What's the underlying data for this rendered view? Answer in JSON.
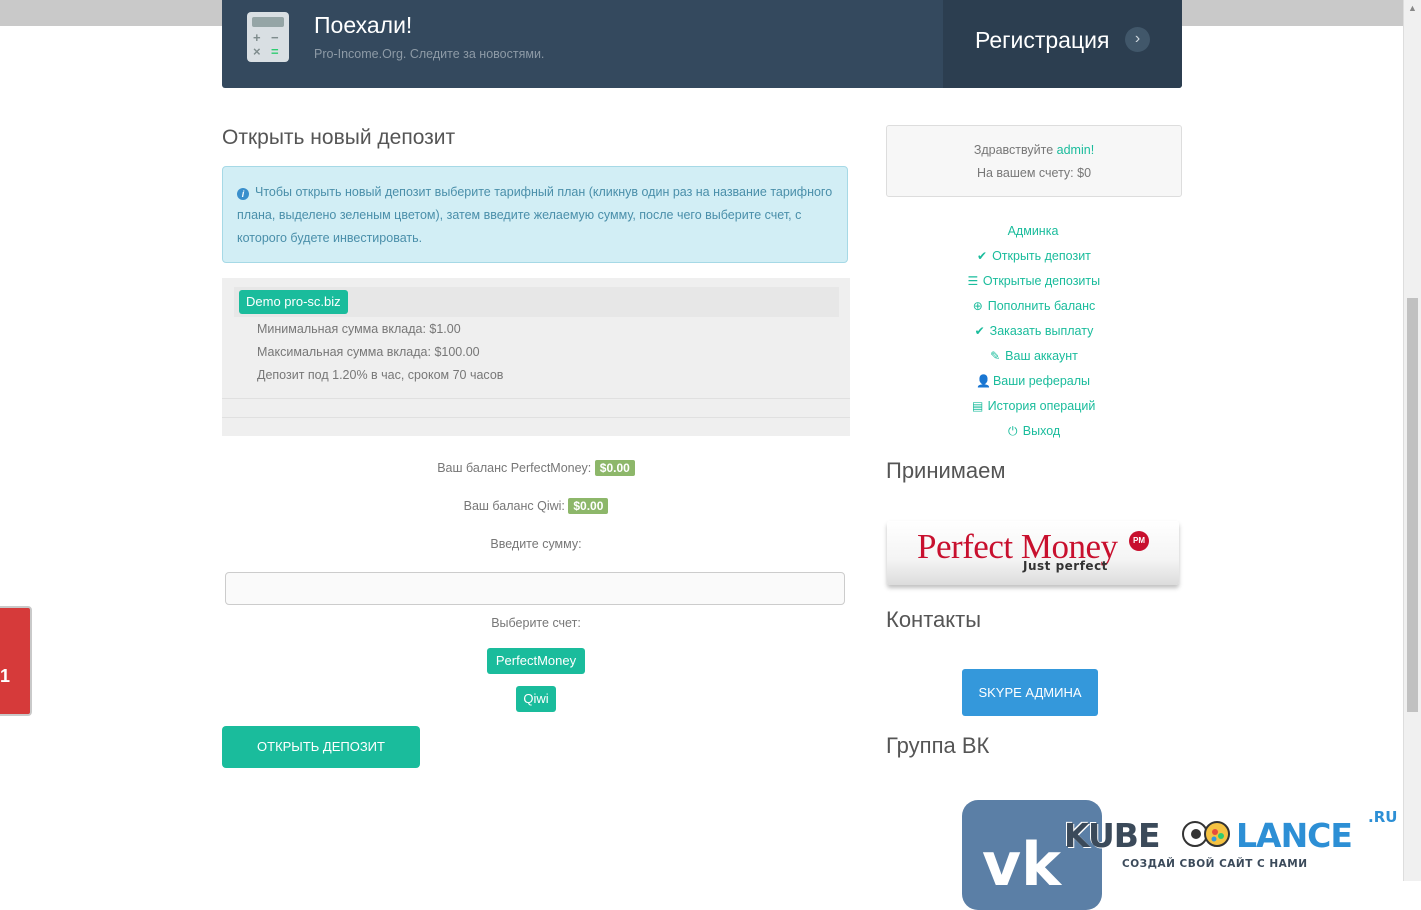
{
  "header": {
    "title": "Поехали!",
    "subtitle": "Pro-Income.Org. Следите за новостями.",
    "register_label": "Регистрация",
    "register_arrow": "›"
  },
  "main": {
    "title": "Открыть новый депозит",
    "info_text": "Чтобы открыть новый депозит выберите тарифный план (кликнув один раз на название тарифного плана, выделено зеленым цветом), затем введите желаемую сумму, после чего выберите счет, с которого будете инвестировать.",
    "plan": {
      "name": "Demo pro-sc.biz",
      "min": "Минимальная сумма вклада: $1.00",
      "max": "Максимальная сумма вклада: $100.00",
      "terms": "Депозит под 1.20% в час, сроком 70 часов"
    },
    "balance_pm_label": "Ваш баланс PerfectMoney:",
    "balance_pm_value": "$0.00",
    "balance_qiwi_label": "Ваш баланс Qiwi:",
    "balance_qiwi_value": "$0.00",
    "amount_label": "Введите сумму:",
    "amount_value": "",
    "account_label": "Выберите счет:",
    "accounts": [
      "PerfectMoney",
      "Qiwi"
    ],
    "submit_label": "ОТКРЫТЬ ДЕПОЗИТ"
  },
  "sidebar": {
    "greeting_prefix": "Здравствуйте ",
    "username": "admin!",
    "balance_text": "На вашем счету: $0",
    "menu": [
      {
        "label": "Админка",
        "icon": ""
      },
      {
        "label": "Открыть депозит",
        "icon": "✔"
      },
      {
        "label": "Открытые депозиты",
        "icon": "☰"
      },
      {
        "label": "Пополнить баланс",
        "icon": "⊕"
      },
      {
        "label": "Заказать выплату",
        "icon": "✔"
      },
      {
        "label": "Ваш аккаунт",
        "icon": "✎"
      },
      {
        "label": "Ваши рефералы",
        "icon": "👤"
      },
      {
        "label": "История операций",
        "icon": "▤"
      },
      {
        "label": "Выход",
        "icon": "⏻"
      }
    ],
    "accept_title": "Принимаем",
    "pm_logo_text": "Perfect Money",
    "pm_logo_sub": "Just perfect",
    "pm_logo_badge": "PM",
    "contacts_title": "Контакты",
    "skype_label": "SKYPE АДМИНА",
    "vk_title": "Группа ВК"
  },
  "side_tab": {
    "number": "1"
  },
  "watermark": {
    "kube": "KUBE",
    "lance": "LANCE",
    "ru": ".RU",
    "tagline": "СОЗДАЙ СВОЙ САЙТ С НАМИ"
  },
  "colors": {
    "accent": "#1abc9c",
    "header_bg": "#34495e",
    "register_bg": "#2c3e50",
    "info_bg": "#d2eef5",
    "skype_btn": "#3498db",
    "balance_badge": "#8db76a"
  }
}
